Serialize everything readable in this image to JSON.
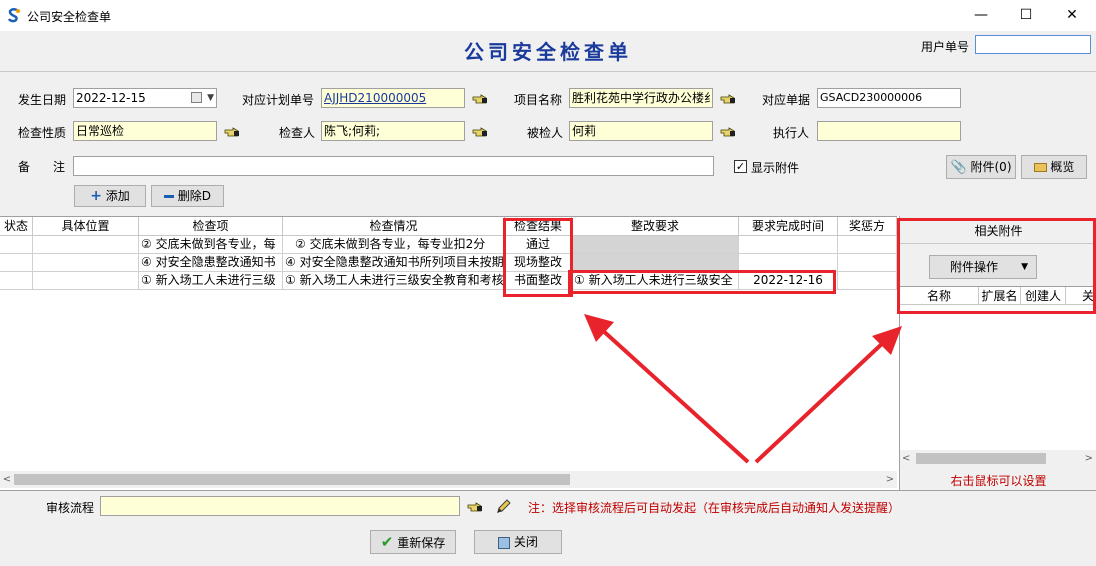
{
  "window": {
    "title": "公司安全检查单",
    "heading": "公司安全检查单",
    "minimize": "—",
    "maximize": "☐",
    "close": "✕"
  },
  "user": {
    "label": "用户单号",
    "value": ""
  },
  "form": {
    "date_label": "发生日期",
    "date_value": "2022-12-15",
    "plan_label": "对应计划单号",
    "plan_value": "AJJHD210000005",
    "project_label": "项目名称",
    "project_value": "胜利花苑中学行政办公楼纟",
    "doc_label": "对应单据",
    "doc_value": "GSACD230000006",
    "nature_label": "检查性质",
    "nature_value": "日常巡检",
    "inspector_label": "检查人",
    "inspector_value": "陈飞;何莉;",
    "inspected_label": "被检人",
    "inspected_value": "何莉",
    "executor_label": "执行人",
    "executor_value": "",
    "remark_label_1": "备",
    "remark_label_2": "注",
    "remark_value": "",
    "show_attach_label": "显示附件",
    "show_attach_checked": true,
    "attach_button": "附件(0)",
    "preview_button": "概览"
  },
  "toolbar": {
    "add_label": "添加",
    "delete_label": "删除D"
  },
  "grid": {
    "columns": [
      "状态",
      "具体位置",
      "检查项",
      "检查情况",
      "检查结果",
      "整改要求",
      "要求完成时间",
      "奖惩方"
    ],
    "rows": [
      {
        "status": "",
        "position": "",
        "item": "② 交底未做到各专业，每",
        "situation": "② 交底未做到各专业，每专业扣2分",
        "result": "通过",
        "requirement": "",
        "due": ""
      },
      {
        "status": "",
        "position": "",
        "item": "④ 对安全隐患整改通知书",
        "situation": "④ 对安全隐患整改通知书所列项目未按期",
        "result": "现场整改",
        "requirement": "",
        "due": ""
      },
      {
        "status": "",
        "position": "",
        "item": "① 新入场工人未进行三级",
        "situation": "① 新入场工人未进行三级安全教育和考核",
        "result": "书面整改",
        "requirement": "① 新入场工人未进行三级安全",
        "due": "2022-12-16"
      }
    ]
  },
  "attachments": {
    "title": "相关附件",
    "ops_button": "附件操作",
    "columns": [
      "名称",
      "扩展名",
      "创建人",
      "关"
    ],
    "note": "右击鼠标可以设置"
  },
  "footer": {
    "flow_label": "审核流程",
    "flow_value": "",
    "hint": "注：选择审核流程后可自动发起（在审核完成后自动通知人发送提醒）",
    "save_button": "重新保存",
    "close_button": "关闭"
  },
  "colors": {
    "heading": "#1a3a9c",
    "annotation": "#e8232b",
    "hint": "#c00000",
    "field_highlight": "#ffffd7"
  }
}
